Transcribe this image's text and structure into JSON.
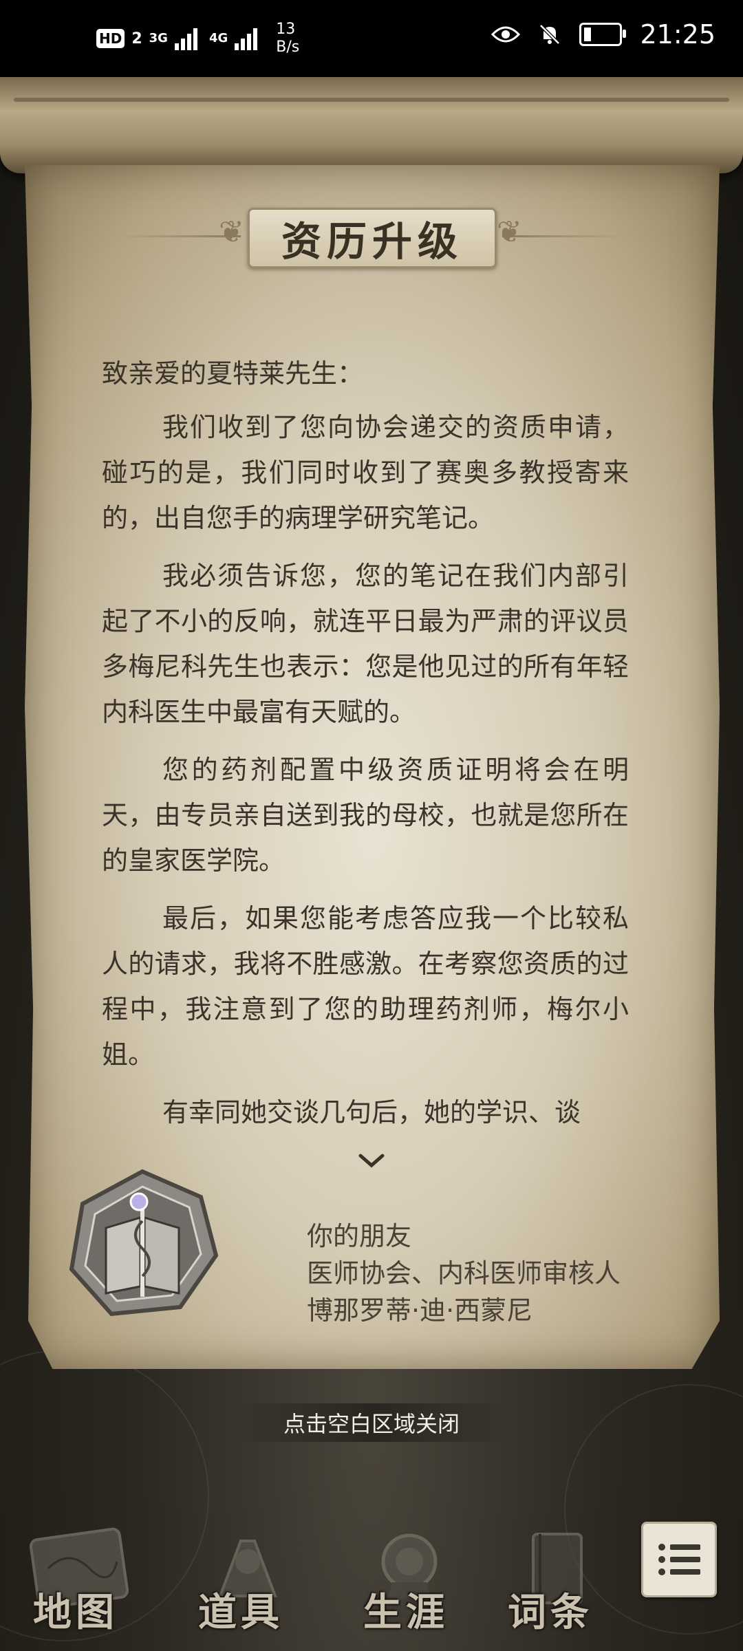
{
  "status_bar": {
    "hd": "HD",
    "sim": "2",
    "net1": "3G",
    "net2": "4G",
    "speed_value": "13",
    "speed_unit": "B/s",
    "time": "21:25"
  },
  "title": "资历升级",
  "letter": {
    "salutation": "致亲爱的夏特莱先生：",
    "paragraphs": [
      "我们收到了您向协会递交的资质申请，碰巧的是，我们同时收到了赛奥多教授寄来的，出自您手的病理学研究笔记。",
      "我必须告诉您，您的笔记在我们内部引起了不小的反响，就连平日最为严肃的评议员多梅尼科先生也表示：您是他见过的所有年轻内科医生中最富有天赋的。",
      "您的药剂配置中级资质证明将会在明天，由专员亲自送到我的母校，也就是您所在的皇家医学院。",
      "最后，如果您能考虑答应我一个比较私人的请求，我将不胜感激。在考察您资质的过程中，我注意到了您的助理药剂师，梅尔小姐。",
      "有幸同她交谈几句后，她的学识、谈"
    ]
  },
  "signature": {
    "line1": "你的朋友",
    "line2": "医师协会、内科医师审核人",
    "line3": "博那罗蒂·迪·西蒙尼"
  },
  "close_hint": "点击空白区域关闭",
  "nav": [
    {
      "label": "地图",
      "icon": "map-icon"
    },
    {
      "label": "道具",
      "icon": "items-icon"
    },
    {
      "label": "生涯",
      "icon": "career-icon"
    },
    {
      "label": "词条",
      "icon": "entries-icon"
    }
  ],
  "colors": {
    "paper": "#e3dac6",
    "ink": "#3b332a",
    "background": "#1c1a16"
  }
}
